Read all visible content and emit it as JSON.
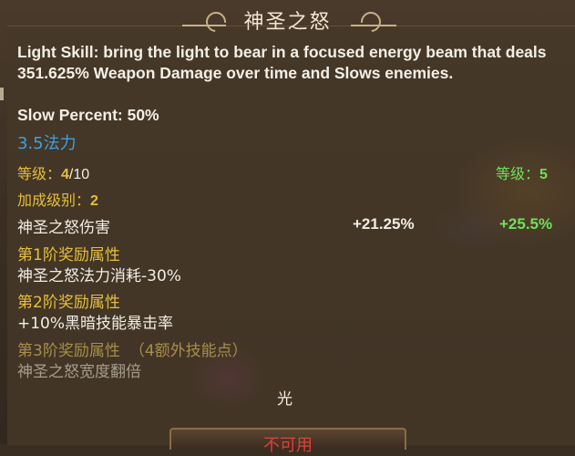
{
  "title": "神圣之怒",
  "description": "Light Skill: bring the light to bear in a focused energy beam that deals 351.625% Weapon Damage over time and Slows enemies.",
  "slow_percent": "Slow Percent: 50%",
  "mana_cost": "3.5法力",
  "level": {
    "label": "等级：",
    "current": "4",
    "max": "/10"
  },
  "next_level": {
    "label": "等级：",
    "value": "5"
  },
  "bonus_level": {
    "label": "加成级别：",
    "value": "2"
  },
  "damage": {
    "label": "神圣之怒伤害",
    "current": "+21.25%",
    "next": "+25.5%"
  },
  "tiers": [
    {
      "heading": "第1阶奖励属性",
      "detail": "神圣之怒法力消耗-30%"
    },
    {
      "heading": "第2阶奖励属性",
      "detail": "+10%黑暗技能暴击率"
    },
    {
      "heading": "第3阶奖励属性",
      "extra": "（4额外技能点）",
      "detail": "神圣之怒宽度翻倍"
    }
  ],
  "element": "光",
  "action_button": "不可用",
  "colors": {
    "gold": "#e6bf3a",
    "mana": "#3aa1e6",
    "bonus": "#6fe05a",
    "unavailable": "#e0403a"
  }
}
